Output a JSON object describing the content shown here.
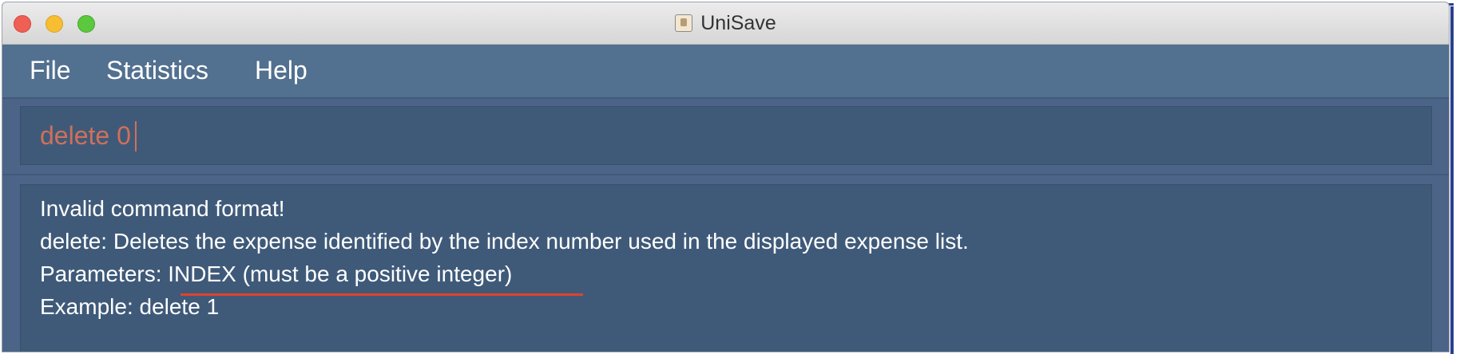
{
  "window": {
    "title": "UniSave",
    "app_icon": "app-icon"
  },
  "titlebar": {
    "buttons": [
      "close",
      "minimize",
      "maximize"
    ],
    "colors": {
      "close": "#ee5f56",
      "minimize": "#f6be30",
      "maximize": "#5cc83e"
    }
  },
  "menu": {
    "items": [
      {
        "label": "File"
      },
      {
        "label": "Statistics"
      },
      {
        "label": "Help"
      }
    ]
  },
  "command": {
    "value": "delete 0",
    "text_color": "#d0705a"
  },
  "result": {
    "lines": [
      "Invalid command format!",
      "delete: Deletes the expense identified by the index number used in the displayed expense list.",
      "Parameters: INDEX (must be a positive integer)",
      "Example: delete 1"
    ],
    "highlight_color": "#e0432c"
  },
  "colors": {
    "background": "#4c6487",
    "panel": "#3f5a79",
    "menubar": "#52708f"
  }
}
